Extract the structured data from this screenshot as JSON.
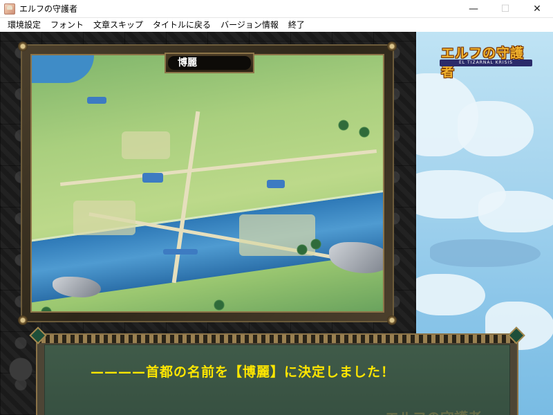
{
  "window": {
    "title": "エルフの守護者",
    "controls": {
      "minimize": "—",
      "maximize": "☐",
      "close": "✕"
    }
  },
  "menu": {
    "items": [
      "環境設定",
      "フォント",
      "文章スキップ",
      "タイトルに戻る",
      "バージョン情報",
      "終了"
    ]
  },
  "logo": {
    "title_jp": "エルフの守護者",
    "subtitle_en": "EL TIZARNAL KRISIS"
  },
  "map": {
    "location_label": "博麗"
  },
  "dialog": {
    "message": "————首都の名前を【博麗】に決定しました！",
    "watermark": "エルフの守護者"
  },
  "colors": {
    "dialog_text": "#ffe600",
    "dialog_bg": "#3f5c4a",
    "frame_gold": "#8c7448"
  }
}
